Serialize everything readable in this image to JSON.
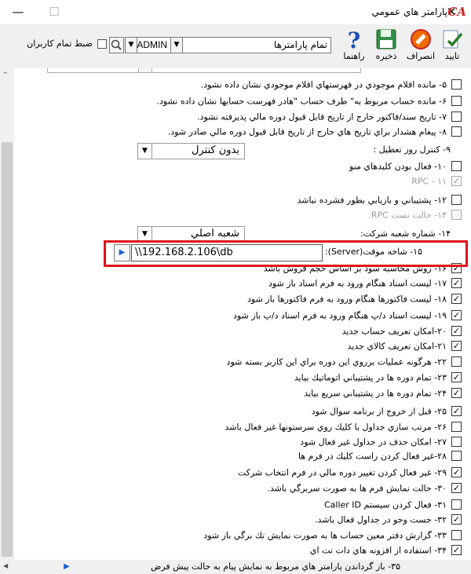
{
  "window": {
    "title": "پارامتر هاي عمومي",
    "logo": "CA"
  },
  "toolbar": {
    "buttons": [
      {
        "label": "تاييد",
        "icon": "confirm-icon"
      },
      {
        "label": "انصراف",
        "icon": "cancel-icon"
      },
      {
        "label": "ذخيره",
        "icon": "save-icon"
      },
      {
        "label": "راهنما",
        "icon": "help-icon"
      }
    ],
    "params_combo": "تمام پارامترها",
    "user_combo": "ADMIN",
    "save_all_users_label": "ضبط تمام كاربران"
  },
  "items": [
    {
      "text": "۵- مانده اقلام موجودي در فهرستهاي اقلام موجودي نشان داده نشود.",
      "checked": false,
      "disabled": false
    },
    {
      "text": "۶- مانده حساب مربوط به\" طرف حساب \"هادر فهرست حسابها نشان داده نشود.",
      "checked": false,
      "disabled": false
    },
    {
      "text": "۷- تاريخ سند/فاكتور خارج از تاريخ قابل قبول دوره مالي پذيرفته نشود.",
      "checked": false,
      "disabled": false
    },
    {
      "text": "۸- پيغام هشدار براي تاريخ هاي خارج از تاريخ قابل قبول دوره مالي صادر شود.",
      "checked": false,
      "disabled": false
    },
    {
      "text": "۱۰- فعال بودن كليدهاي منو",
      "checked": false,
      "disabled": false
    },
    {
      "text": "RPC - ۱۱",
      "checked": true,
      "disabled": true
    },
    {
      "text": "۱۲- پشتيباني و بازيابي بطور فشرده نباشد",
      "checked": false,
      "disabled": false
    },
    {
      "text": "۱۳- حالت تست RPC.",
      "checked": false,
      "disabled": true
    },
    {
      "text": "۱۶- روش محاسبه سود بر اساس حجم فروش باشد",
      "checked": true,
      "disabled": false
    },
    {
      "text": "۱۷- ليست اسناد هنگام ورود به فرم اسناد باز شود",
      "checked": true,
      "disabled": false
    },
    {
      "text": "۱۸- ليست فاكتورها هنگام ورود به فرم فاكتورها باز شود",
      "checked": true,
      "disabled": false
    },
    {
      "text": "۱۹- ليست اسناد د/پ هنگام ورود به فرم اسناد د/پ باز شود",
      "checked": true,
      "disabled": false
    },
    {
      "text": "۲۰-امكان تعريف حساب جديد",
      "checked": true,
      "disabled": false
    },
    {
      "text": "۲۱-امكان تعريف كالاي جديد",
      "checked": true,
      "disabled": false
    },
    {
      "text": "۲۲- هرگونه عمليات برروي اين دوره براي اين كاربر بسته شود",
      "checked": false,
      "disabled": false
    },
    {
      "text": "۲۳- تمام دوره ها در پشتيباني اتوماتيك بيايد",
      "checked": true,
      "disabled": false
    },
    {
      "text": "۲۴- تمام دوره ها در پشتيباني سريع بيايد",
      "checked": true,
      "disabled": false
    },
    {
      "text": "۲۵- قبل از خروج از برنامه سوال شود",
      "checked": true,
      "disabled": false
    },
    {
      "text": "۲۶- مرتب سازي جداول با كليك روي سرستونها غير فعال باشد",
      "checked": false,
      "disabled": false
    },
    {
      "text": "۲۷- امكان حذف در جداول غير فعال شود",
      "checked": false,
      "disabled": false
    },
    {
      "text": "۲۸-غير فعال كردن راست كليك در فرم ها",
      "checked": false,
      "disabled": false
    },
    {
      "text": "۲۹- غير فعال كردن تغيير دوره مالي در فرم انتخاب شركت",
      "checked": true,
      "disabled": false
    },
    {
      "text": "۳۰- حالت نمايش فرم ها به صورت سربرگي  باشد.",
      "checked": true,
      "disabled": false
    },
    {
      "text": "۳۱- فعال كردن سيستم Caller ID",
      "checked": false,
      "disabled": false
    },
    {
      "text": "۳۲- جست وجو در جداول فعال باشد.",
      "checked": true,
      "disabled": false
    },
    {
      "text": "۳۳- گزارش دفتر معين حساب ها به صورت نمايش تك برگي باز شود",
      "checked": false,
      "disabled": false
    },
    {
      "text": "۳۴- استفاده از افزونه هاي دات نت اي",
      "checked": true,
      "disabled": false
    }
  ],
  "control_row": {
    "label": "۹- كنترل روز تعطيل :",
    "value": "بدون كنترل"
  },
  "branch_row": {
    "label": "۱۴- شماره شعبه شركت:",
    "value": "شعبه اصلي"
  },
  "server_row": {
    "label": "۱۵- شاخه موقت(Server):",
    "value": "\\\\192.168.2.106\\db"
  },
  "bottom_text": "۳۵- باز گرداندن پارامتر هاي مربوط به نمايش پيام به حالت پيش فرض"
}
